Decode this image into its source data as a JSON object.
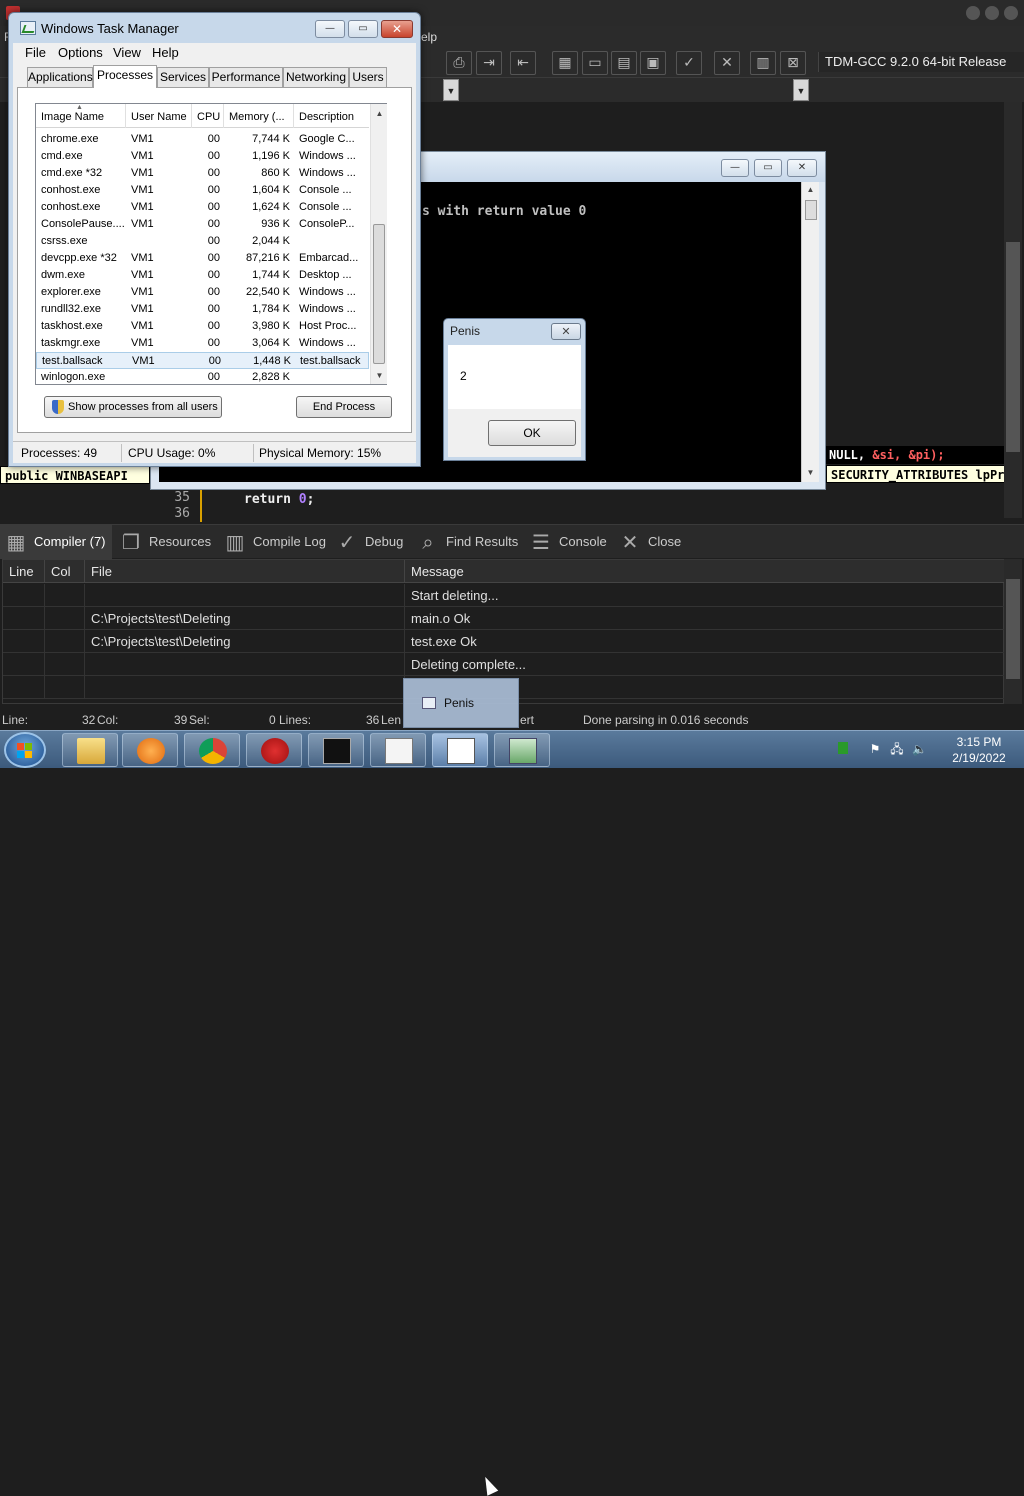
{
  "ide": {
    "menu_visible_fragment": "elp",
    "menu_left_fragment": "F",
    "compiler_profile": "TDM-GCC 9.2.0 64-bit Release",
    "editor": {
      "line_numbers": [
        "35",
        "36"
      ],
      "code_return": "return",
      "code_zero": "0",
      "code_semicolon": ";",
      "right_call_tail_a": "NULL, ",
      "right_call_tail_b": "&si, &pi);",
      "hint_left": "public WINBASEAPI",
      "hint_right": "SECURITY_ATTRIBUTES lpPr"
    },
    "bottom_tabs": [
      {
        "label": "Compiler (7)",
        "icon": "grid-icon"
      },
      {
        "label": "Resources",
        "icon": "resources-icon"
      },
      {
        "label": "Compile Log",
        "icon": "bar-chart-icon"
      },
      {
        "label": "Debug",
        "icon": "check-icon"
      },
      {
        "label": "Find Results",
        "icon": "find-icon"
      },
      {
        "label": "Console",
        "icon": "console-icon"
      },
      {
        "label": "Close",
        "icon": "close-icon"
      }
    ],
    "messages": {
      "columns": [
        "Line",
        "Col",
        "File",
        "Message"
      ],
      "rows": [
        {
          "line": "",
          "col": "",
          "file": "",
          "message": "Start deleting..."
        },
        {
          "line": "",
          "col": "",
          "file": "C:\\Projects\\test\\Deleting",
          "message": "main.o Ok"
        },
        {
          "line": "",
          "col": "",
          "file": "C:\\Projects\\test\\Deleting",
          "message": "test.exe Ok"
        },
        {
          "line": "",
          "col": "",
          "file": "",
          "message": "Deleting complete..."
        },
        {
          "line": "",
          "col": "",
          "file": "",
          "message": ""
        }
      ]
    },
    "status": {
      "line": "Line:",
      "line_val": "32",
      "col": "Col:",
      "col_val": "39",
      "sel": "Sel:",
      "sel_val": "0",
      "lines": "Lines:",
      "lines_val": "36",
      "len": "Len",
      "insert": "ert",
      "parse_msg": "Done parsing in 0.016 seconds"
    }
  },
  "console": {
    "output": "s with return value 0"
  },
  "taskmgr": {
    "title": "Windows Task Manager",
    "menu": [
      "File",
      "Options",
      "View",
      "Help"
    ],
    "tabs": [
      "Applications",
      "Processes",
      "Services",
      "Performance",
      "Networking",
      "Users"
    ],
    "active_tab": "Processes",
    "columns": [
      "Image Name",
      "User Name",
      "CPU",
      "Memory (...",
      "Description"
    ],
    "processes": [
      {
        "name": "chrome.exe",
        "user": "VM1",
        "cpu": "00",
        "mem": "7,744 K",
        "desc": "Google C..."
      },
      {
        "name": "cmd.exe",
        "user": "VM1",
        "cpu": "00",
        "mem": "1,196 K",
        "desc": "Windows ..."
      },
      {
        "name": "cmd.exe *32",
        "user": "VM1",
        "cpu": "00",
        "mem": "860 K",
        "desc": "Windows ..."
      },
      {
        "name": "conhost.exe",
        "user": "VM1",
        "cpu": "00",
        "mem": "1,604 K",
        "desc": "Console ..."
      },
      {
        "name": "conhost.exe",
        "user": "VM1",
        "cpu": "00",
        "mem": "1,624 K",
        "desc": "Console ..."
      },
      {
        "name": "ConsolePause....",
        "user": "VM1",
        "cpu": "00",
        "mem": "936 K",
        "desc": "ConsoleP..."
      },
      {
        "name": "csrss.exe",
        "user": "",
        "cpu": "00",
        "mem": "2,044 K",
        "desc": ""
      },
      {
        "name": "devcpp.exe *32",
        "user": "VM1",
        "cpu": "00",
        "mem": "87,216 K",
        "desc": "Embarcad..."
      },
      {
        "name": "dwm.exe",
        "user": "VM1",
        "cpu": "00",
        "mem": "1,744 K",
        "desc": "Desktop ..."
      },
      {
        "name": "explorer.exe",
        "user": "VM1",
        "cpu": "00",
        "mem": "22,540 K",
        "desc": "Windows ..."
      },
      {
        "name": "rundll32.exe",
        "user": "VM1",
        "cpu": "00",
        "mem": "1,784 K",
        "desc": "Windows ..."
      },
      {
        "name": "taskhost.exe",
        "user": "VM1",
        "cpu": "00",
        "mem": "3,980 K",
        "desc": "Host Proc..."
      },
      {
        "name": "taskmgr.exe",
        "user": "VM1",
        "cpu": "00",
        "mem": "3,064 K",
        "desc": "Windows ..."
      },
      {
        "name": "test.ballsack",
        "user": "VM1",
        "cpu": "00",
        "mem": "1,448 K",
        "desc": "test.ballsack"
      },
      {
        "name": "winlogon.exe",
        "user": "",
        "cpu": "00",
        "mem": "2,828 K",
        "desc": ""
      }
    ],
    "selected_process": "test.ballsack",
    "show_all_label": "Show processes from all users",
    "end_process_label": "End Process",
    "status": {
      "processes": "Processes: 49",
      "cpu": "CPU Usage: 0%",
      "memory": "Physical Memory: 15%"
    }
  },
  "msgbox": {
    "title": "Penis",
    "text": "2",
    "ok_label": "OK"
  },
  "taskbar": {
    "preview_label": "Penis",
    "apps": [
      "explorer",
      "media-player",
      "chrome",
      "devcpp",
      "cmd",
      "notepad",
      "window",
      "taskmgr"
    ],
    "active_app": "window",
    "clock_time": "3:15 PM",
    "clock_date": "2/19/2022"
  },
  "colors": {
    "ide_bg": "#1e1e1e",
    "taskbar": "#3c5a7c",
    "selection": "#e6f0fa",
    "close_red": "#c8442c"
  }
}
